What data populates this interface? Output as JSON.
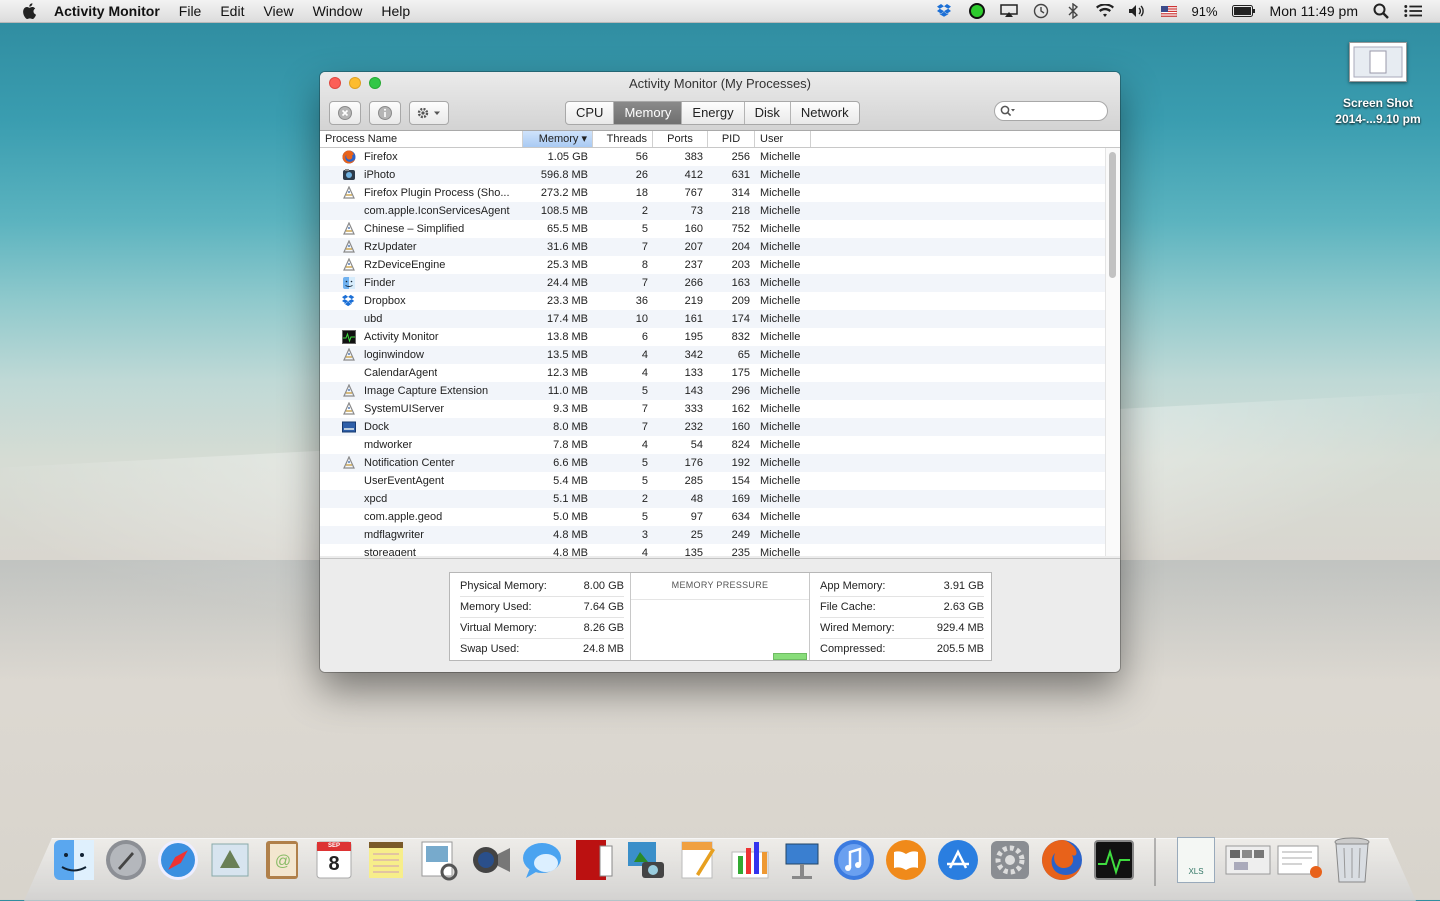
{
  "menubar": {
    "app_name": "Activity Monitor",
    "menus": [
      "File",
      "Edit",
      "View",
      "Window",
      "Help"
    ],
    "battery": "91%",
    "clock": "Mon 11:49 pm"
  },
  "desktop": {
    "icon_label_1": "Screen Shot",
    "icon_label_2": "2014-...9.10 pm"
  },
  "window": {
    "title": "Activity Monitor (My Processes)",
    "tabs": [
      "CPU",
      "Memory",
      "Energy",
      "Disk",
      "Network"
    ],
    "active_tab": "Memory",
    "search_placeholder": "",
    "columns": [
      "Process Name",
      "Memory ▾",
      "Threads",
      "Ports",
      "PID",
      "User"
    ],
    "processes": [
      {
        "name": "Firefox",
        "memory": "1.05 GB",
        "threads": "56",
        "ports": "383",
        "pid": "256",
        "user": "Michelle",
        "icon": "firefox-icon"
      },
      {
        "name": "iPhoto",
        "memory": "596.8 MB",
        "threads": "26",
        "ports": "412",
        "pid": "631",
        "user": "Michelle",
        "icon": "iphoto-icon"
      },
      {
        "name": "Firefox Plugin Process (Sho...",
        "memory": "273.2 MB",
        "threads": "18",
        "ports": "767",
        "pid": "314",
        "user": "Michelle",
        "icon": "generic-app-icon"
      },
      {
        "name": "com.apple.IconServicesAgent",
        "memory": "108.5 MB",
        "threads": "2",
        "ports": "73",
        "pid": "218",
        "user": "Michelle",
        "icon": ""
      },
      {
        "name": "Chinese – Simplified",
        "memory": "65.5 MB",
        "threads": "5",
        "ports": "160",
        "pid": "752",
        "user": "Michelle",
        "icon": "generic-app-icon"
      },
      {
        "name": "RzUpdater",
        "memory": "31.6 MB",
        "threads": "7",
        "ports": "207",
        "pid": "204",
        "user": "Michelle",
        "icon": "generic-app-icon"
      },
      {
        "name": "RzDeviceEngine",
        "memory": "25.3 MB",
        "threads": "8",
        "ports": "237",
        "pid": "203",
        "user": "Michelle",
        "icon": "generic-app-icon"
      },
      {
        "name": "Finder",
        "memory": "24.4 MB",
        "threads": "7",
        "ports": "266",
        "pid": "163",
        "user": "Michelle",
        "icon": "finder-icon"
      },
      {
        "name": "Dropbox",
        "memory": "23.3 MB",
        "threads": "36",
        "ports": "219",
        "pid": "209",
        "user": "Michelle",
        "icon": "dropbox-icon"
      },
      {
        "name": "ubd",
        "memory": "17.4 MB",
        "threads": "10",
        "ports": "161",
        "pid": "174",
        "user": "Michelle",
        "icon": ""
      },
      {
        "name": "Activity Monitor",
        "memory": "13.8 MB",
        "threads": "6",
        "ports": "195",
        "pid": "832",
        "user": "Michelle",
        "icon": "activity-monitor-icon"
      },
      {
        "name": "loginwindow",
        "memory": "13.5 MB",
        "threads": "4",
        "ports": "342",
        "pid": "65",
        "user": "Michelle",
        "icon": "generic-app-icon"
      },
      {
        "name": "CalendarAgent",
        "memory": "12.3 MB",
        "threads": "4",
        "ports": "133",
        "pid": "175",
        "user": "Michelle",
        "icon": ""
      },
      {
        "name": "Image Capture Extension",
        "memory": "11.0 MB",
        "threads": "5",
        "ports": "143",
        "pid": "296",
        "user": "Michelle",
        "icon": "generic-app-icon"
      },
      {
        "name": "SystemUIServer",
        "memory": "9.3 MB",
        "threads": "7",
        "ports": "333",
        "pid": "162",
        "user": "Michelle",
        "icon": "generic-app-icon"
      },
      {
        "name": "Dock",
        "memory": "8.0 MB",
        "threads": "7",
        "ports": "232",
        "pid": "160",
        "user": "Michelle",
        "icon": "dock-icon"
      },
      {
        "name": "mdworker",
        "memory": "7.8 MB",
        "threads": "4",
        "ports": "54",
        "pid": "824",
        "user": "Michelle",
        "icon": ""
      },
      {
        "name": "Notification Center",
        "memory": "6.6 MB",
        "threads": "5",
        "ports": "176",
        "pid": "192",
        "user": "Michelle",
        "icon": "generic-app-icon"
      },
      {
        "name": "UserEventAgent",
        "memory": "5.4 MB",
        "threads": "5",
        "ports": "285",
        "pid": "154",
        "user": "Michelle",
        "icon": ""
      },
      {
        "name": "xpcd",
        "memory": "5.1 MB",
        "threads": "2",
        "ports": "48",
        "pid": "169",
        "user": "Michelle",
        "icon": ""
      },
      {
        "name": "com.apple.geod",
        "memory": "5.0 MB",
        "threads": "5",
        "ports": "97",
        "pid": "634",
        "user": "Michelle",
        "icon": ""
      },
      {
        "name": "mdflagwriter",
        "memory": "4.8 MB",
        "threads": "3",
        "ports": "25",
        "pid": "249",
        "user": "Michelle",
        "icon": ""
      },
      {
        "name": "storeagent",
        "memory": "4.8 MB",
        "threads": "4",
        "ports": "135",
        "pid": "235",
        "user": "Michelle",
        "icon": ""
      }
    ],
    "stats_left": [
      {
        "label": "Physical Memory:",
        "value": "8.00 GB"
      },
      {
        "label": "Memory Used:",
        "value": "7.64 GB"
      },
      {
        "label": "Virtual Memory:",
        "value": "8.26 GB"
      },
      {
        "label": "Swap Used:",
        "value": "24.8 MB"
      }
    ],
    "pressure_title": "MEMORY PRESSURE",
    "stats_right": [
      {
        "label": "App Memory:",
        "value": "3.91 GB"
      },
      {
        "label": "File Cache:",
        "value": "2.63 GB"
      },
      {
        "label": "Wired Memory:",
        "value": "929.4 MB"
      },
      {
        "label": "Compressed:",
        "value": "205.5 MB"
      }
    ]
  },
  "dock": {
    "apps": [
      "finder-icon",
      "launchpad-icon",
      "safari-icon",
      "mail-icon",
      "contacts-icon",
      "calendar-icon",
      "notes-icon",
      "preview-icon",
      "facetime-icon",
      "messages-icon",
      "photo-booth-icon",
      "iphoto-icon",
      "pages-icon",
      "numbers-icon",
      "keynote-icon",
      "itunes-icon",
      "ibooks-icon",
      "app-store-icon",
      "system-preferences-icon",
      "firefox-icon",
      "activity-monitor-icon"
    ],
    "calendar_day": "8",
    "calendar_month": "SEP",
    "xls_label": "XLS",
    "colors": {
      "accent": "#6f6f6f",
      "pressure_green": "#88dd7a"
    }
  }
}
